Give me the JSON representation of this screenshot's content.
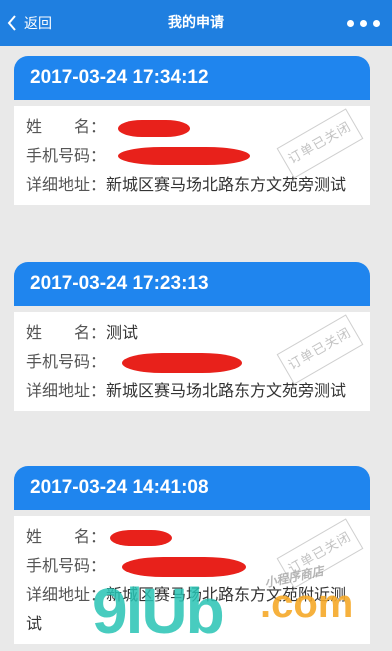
{
  "header": {
    "back_label": "返回",
    "title": "我的申请",
    "more_icon": "more-dots-icon"
  },
  "labels": {
    "name": "姓　　名：",
    "phone": "手机号码：",
    "address": "详细地址："
  },
  "orders": [
    {
      "date": "2017-03-24 17:34:12",
      "name": "",
      "phone": "",
      "address": "新城区赛马场北路东方文苑旁测试",
      "status": "订单已关闭"
    },
    {
      "date": "2017-03-24 17:23:13",
      "name": "测试",
      "phone": "",
      "address": "新城区赛马场北路东方文苑旁测试",
      "status": "订单已关闭"
    },
    {
      "date": "2017-03-24 14:41:08",
      "name": "",
      "phone": "",
      "address": "新城区赛马场北路东方文苑附近测试",
      "status": "订单已关闭"
    }
  ],
  "watermark": {
    "main": "9lUb",
    "suffix": ".com",
    "small": "小程序商店"
  }
}
